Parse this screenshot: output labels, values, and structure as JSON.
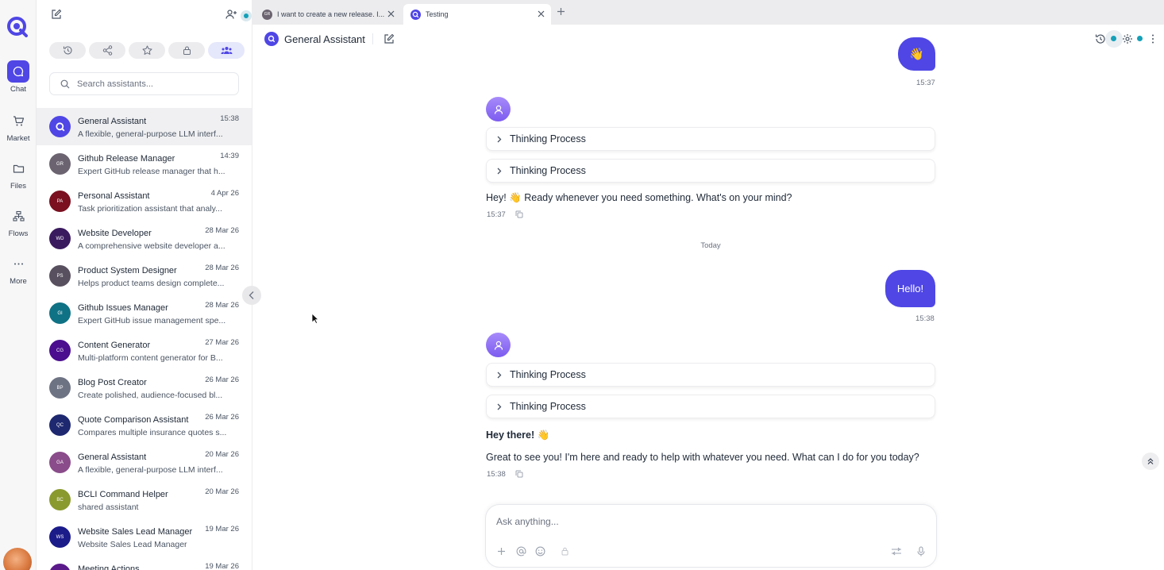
{
  "rail": {
    "items": [
      {
        "label": "Chat",
        "icon": "chat-bubble-icon",
        "active": true
      },
      {
        "label": "Market",
        "icon": "cart-icon"
      },
      {
        "label": "Files",
        "icon": "folder-icon"
      },
      {
        "label": "Flows",
        "icon": "flows-icon"
      },
      {
        "label": "More",
        "icon": "more-dots-icon"
      }
    ]
  },
  "sidebar": {
    "search_placeholder": "Search assistants...",
    "filters": [
      "history-icon",
      "share-icon",
      "star-icon",
      "lock-icon",
      "team-icon"
    ],
    "assistants": [
      {
        "name": "General Assistant",
        "desc": "A flexible, general-purpose LLM interf...",
        "time": "15:38",
        "initials": "",
        "color": "#4f46e5",
        "logo": true
      },
      {
        "name": "Github Release Manager",
        "desc": "Expert GitHub release manager that h...",
        "time": "14:39",
        "initials": "GR",
        "color": "#6b6470"
      },
      {
        "name": "Personal Assistant",
        "desc": "Task prioritization assistant that analy...",
        "time": "4 Apr 26",
        "initials": "PA",
        "color": "#7a1020"
      },
      {
        "name": "Website Developer",
        "desc": "A comprehensive website developer a...",
        "time": "28 Mar 26",
        "initials": "WD",
        "color": "#3a1a5e"
      },
      {
        "name": "Product System Designer",
        "desc": "Helps product teams design complete...",
        "time": "28 Mar 26",
        "initials": "PS",
        "color": "#58505e"
      },
      {
        "name": "Github Issues Manager",
        "desc": "Expert GitHub issue management spe...",
        "time": "28 Mar 26",
        "initials": "GI",
        "color": "#0f7285"
      },
      {
        "name": "Content Generator",
        "desc": "Multi-platform content generator for B...",
        "time": "27 Mar 26",
        "initials": "CG",
        "color": "#4a0e8f"
      },
      {
        "name": "Blog Post Creator",
        "desc": "Create polished, audience-focused bl...",
        "time": "26 Mar 26",
        "initials": "BP",
        "color": "#6e7384"
      },
      {
        "name": "Quote Comparison Assistant",
        "desc": "Compares multiple insurance quotes s...",
        "time": "26 Mar 26",
        "initials": "QC",
        "color": "#1e2870"
      },
      {
        "name": "General Assistant",
        "desc": "A flexible, general-purpose LLM interf...",
        "time": "20 Mar 26",
        "initials": "GA",
        "color": "#8a4c8a"
      },
      {
        "name": "BCLI Command Helper",
        "desc": "shared assistant",
        "time": "20 Mar 26",
        "initials": "BC",
        "color": "#8a9a2e"
      },
      {
        "name": "Website Sales Lead Manager",
        "desc": "Website Sales Lead Manager",
        "time": "19 Mar 26",
        "initials": "WS",
        "color": "#1b1b8a"
      },
      {
        "name": "Meeting Actions",
        "desc": "",
        "time": "19 Mar 26",
        "initials": "MA",
        "color": "#5a1a8a"
      }
    ]
  },
  "tabs": [
    {
      "title": "I want to create a new release. I...",
      "initials": "GR",
      "color": "#6b6470"
    },
    {
      "title": "Testing",
      "logo": true,
      "color": "#4f46e5"
    }
  ],
  "chat": {
    "title": "General Assistant",
    "day_separator": "Today",
    "composer_placeholder": "Ask anything...",
    "messages": {
      "user1": {
        "text": "👋",
        "time": "15:37"
      },
      "bot1": {
        "thinking": [
          "Thinking Process",
          "Thinking Process"
        ],
        "text": "Hey! 👋 Ready whenever you need something. What's on your mind?",
        "time": "15:37"
      },
      "user2": {
        "text": "Hello!",
        "time": "15:38"
      },
      "bot2": {
        "thinking": [
          "Thinking Process",
          "Thinking Process"
        ],
        "heading": "Hey there! 👋",
        "text": "Great to see you! I'm here and ready to help with whatever you need. What can I do for you today?",
        "time": "15:38"
      }
    }
  },
  "colors": {
    "accent": "#4f46e5",
    "status": "#14a0b8"
  }
}
